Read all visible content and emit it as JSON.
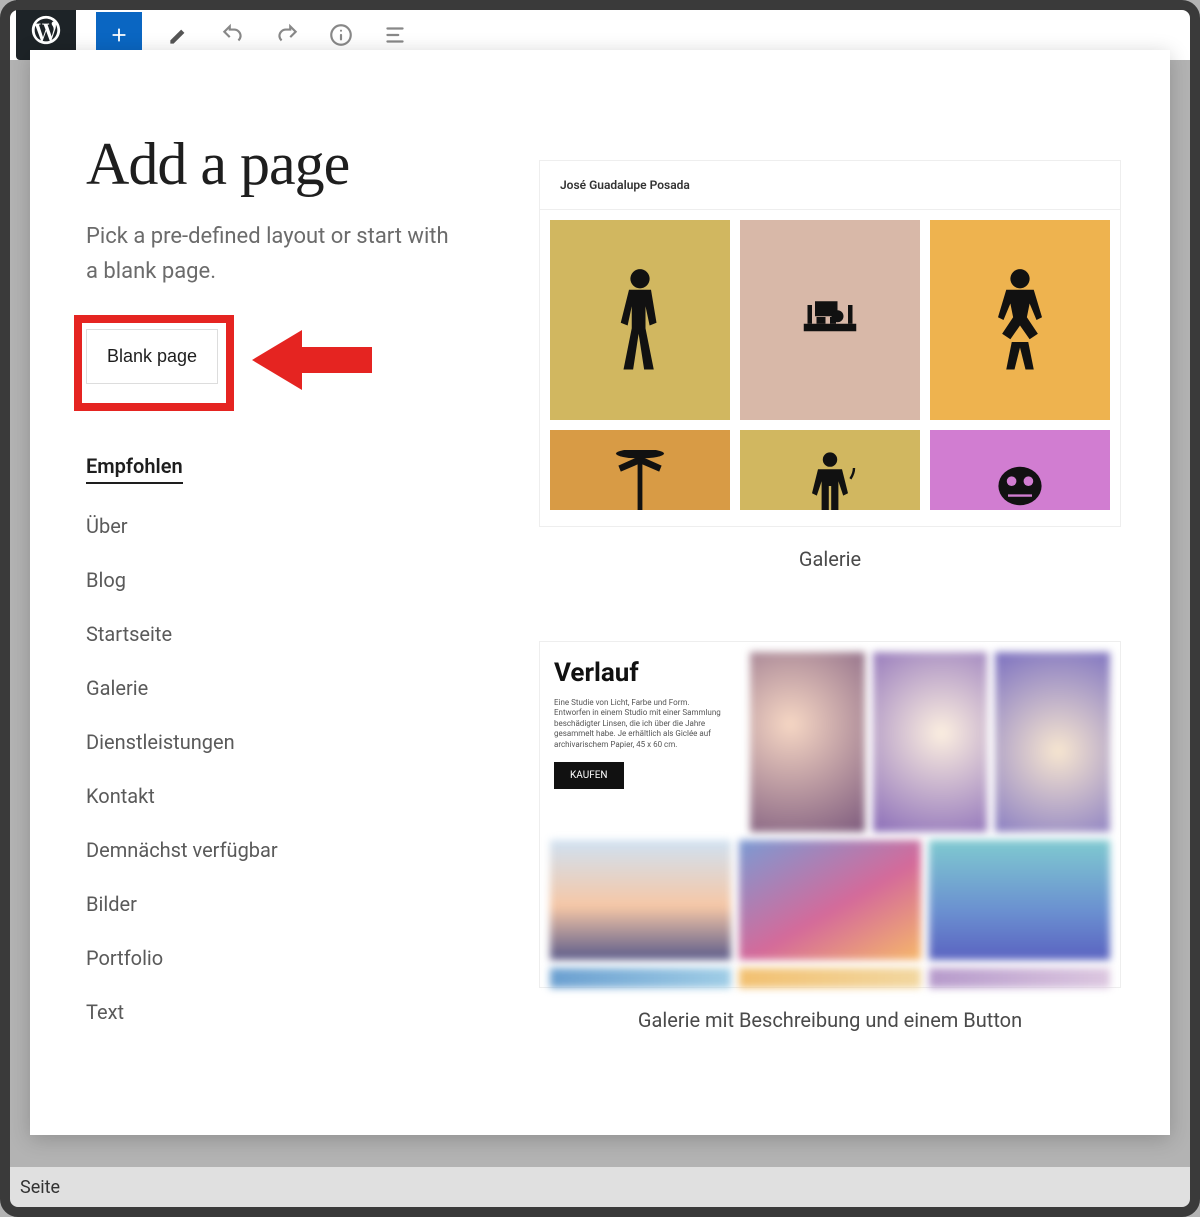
{
  "topbar": {},
  "modal": {
    "title": "Add a page",
    "subtitle": "Pick a pre-defined layout or start with a blank page.",
    "blank_button": "Blank page",
    "categories": [
      {
        "label": "Empfohlen",
        "active": true
      },
      {
        "label": "Über",
        "active": false
      },
      {
        "label": "Blog",
        "active": false
      },
      {
        "label": "Startseite",
        "active": false
      },
      {
        "label": "Galerie",
        "active": false
      },
      {
        "label": "Dienstleistungen",
        "active": false
      },
      {
        "label": "Kontakt",
        "active": false
      },
      {
        "label": "Demnächst verfügbar",
        "active": false
      },
      {
        "label": "Bilder",
        "active": false
      },
      {
        "label": "Portfolio",
        "active": false
      },
      {
        "label": "Text",
        "active": false
      }
    ],
    "templates": {
      "t1": {
        "heading": "José Guadalupe Posada",
        "label": "Galerie"
      },
      "t2": {
        "heading": "Verlauf",
        "body": "Eine Studie von Licht, Farbe und Form. Entworfen in einem Studio mit einer Sammlung beschädigter Linsen, die ich über die Jahre gesammelt habe. Je erhältlich als Giclée auf archivarischem Papier, 45 x 60 cm.",
        "button": "KAUFEN",
        "label": "Galerie mit Beschreibung und einem Button"
      }
    }
  },
  "bottom_text": "Seite"
}
